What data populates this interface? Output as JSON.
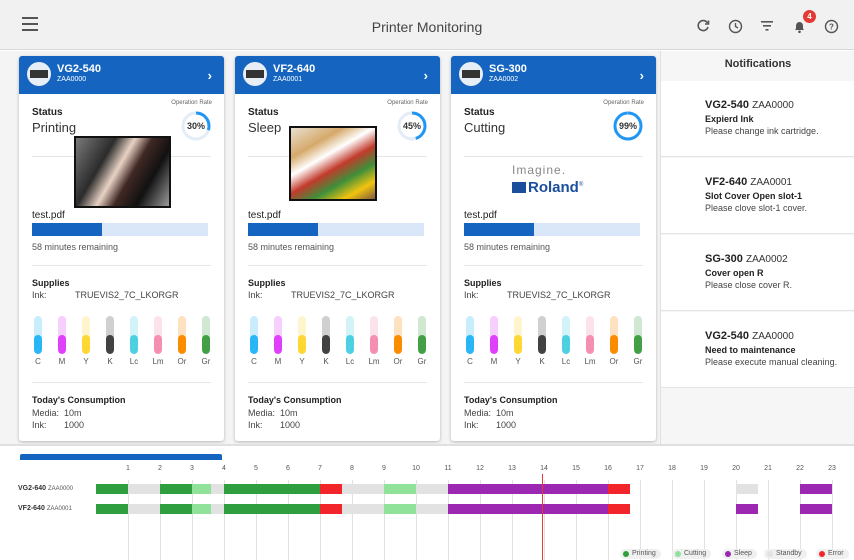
{
  "header": {
    "title": "Printer Monitoring",
    "notification_count": "4"
  },
  "common": {
    "status_label": "Status",
    "operation_rate_label": "Operation Rate",
    "supplies_label": "Supplies",
    "ink_label": "Ink:",
    "consumption_label": "Today's Consumption",
    "media_label": "Media:",
    "ink_row_label": "Ink:"
  },
  "cards": [
    {
      "name": "VG2-540",
      "id": "ZAA0000",
      "status": "Printing",
      "rate": 30,
      "rate_label": "30%",
      "job": "test.pdf",
      "progress": 0.4,
      "remaining": "58 minutes remaining",
      "ink_name": "TRUEVIS2_7C_LKORGR",
      "media": "10m",
      "ink": "1000"
    },
    {
      "name": "VF2-640",
      "id": "ZAA0001",
      "status": "Sleep",
      "rate": 45,
      "rate_label": "45%",
      "job": "test.pdf",
      "progress": 0.4,
      "remaining": "58 minutes remaining",
      "ink_name": "TRUEVIS2_7C_LKORGR",
      "media": "10m",
      "ink": "1000"
    },
    {
      "name": "SG-300",
      "id": "ZAA0002",
      "status": "Cutting",
      "rate": 99,
      "rate_label": "99%",
      "job": "test.pdf",
      "progress": 0.4,
      "remaining": "58 minutes remaining",
      "ink_name": "TRUEVIS2_7C_LKORGR",
      "media": "10m",
      "ink": "1000"
    }
  ],
  "logo": {
    "tagline": "Imagine.",
    "brand": "Roland",
    "tm": "®"
  },
  "inks": [
    {
      "label": "C",
      "color": "#29b6f6",
      "level": 0.5
    },
    {
      "label": "M",
      "color": "#e040fb",
      "level": 0.5
    },
    {
      "label": "Y",
      "color": "#fdd835",
      "level": 0.5
    },
    {
      "label": "K",
      "color": "#424242",
      "level": 0.5
    },
    {
      "label": "Lc",
      "color": "#4dd0e1",
      "level": 0.5
    },
    {
      "label": "Lm",
      "color": "#f48fb1",
      "level": 0.5
    },
    {
      "label": "Or",
      "color": "#fb8c00",
      "level": 0.5
    },
    {
      "label": "Gr",
      "color": "#43a047",
      "level": 0.5
    }
  ],
  "notifications": {
    "title": "Notifications",
    "items": [
      {
        "printer": "VG2-540",
        "id": "ZAA0000",
        "title": "Expierd Ink",
        "message": "Please change ink cartridge."
      },
      {
        "printer": "VF2-640",
        "id": "ZAA0001",
        "title": "Slot Cover Open slot-1",
        "message": "Please clove slot-1 cover."
      },
      {
        "printer": "SG-300",
        "id": "ZAA0002",
        "title": "Cover open R",
        "message": "Please close cover R."
      },
      {
        "printer": "VG2-540",
        "id": "ZAA0000",
        "title": "Need to maintenance",
        "message": "Please execute manual cleaning."
      }
    ]
  },
  "timeline": {
    "hours": [
      "1",
      "2",
      "3",
      "4",
      "5",
      "6",
      "7",
      "8",
      "9",
      "10",
      "11",
      "12",
      "13",
      "14",
      "15",
      "16",
      "17",
      "18",
      "19",
      "20",
      "21",
      "22",
      "23"
    ],
    "rows": [
      {
        "name": "VG2-640",
        "id": "ZAA0000",
        "segments": [
          {
            "state": "printing",
            "start": 0,
            "end": 1
          },
          {
            "state": "standby",
            "start": 1,
            "end": 2
          },
          {
            "state": "printing",
            "start": 2,
            "end": 3
          },
          {
            "state": "cutting",
            "start": 3,
            "end": 3.6
          },
          {
            "state": "standby",
            "start": 3.6,
            "end": 4
          },
          {
            "state": "printing",
            "start": 4,
            "end": 7
          },
          {
            "state": "error",
            "start": 7,
            "end": 7.7
          },
          {
            "state": "standby",
            "start": 7.7,
            "end": 9
          },
          {
            "state": "cutting",
            "start": 9,
            "end": 10
          },
          {
            "state": "standby",
            "start": 10,
            "end": 11
          },
          {
            "state": "sleep",
            "start": 11,
            "end": 16
          },
          {
            "state": "error",
            "start": 16,
            "end": 16.7
          },
          {
            "state": "standby",
            "start": 20,
            "end": 20.7
          },
          {
            "state": "sleep",
            "start": 22,
            "end": 23
          }
        ]
      },
      {
        "name": "VF2-640",
        "id": "ZAA0001",
        "segments": [
          {
            "state": "printing",
            "start": 0,
            "end": 1
          },
          {
            "state": "standby",
            "start": 1,
            "end": 2
          },
          {
            "state": "printing",
            "start": 2,
            "end": 3
          },
          {
            "state": "cutting",
            "start": 3,
            "end": 3.6
          },
          {
            "state": "standby",
            "start": 3.6,
            "end": 4
          },
          {
            "state": "printing",
            "start": 4,
            "end": 7
          },
          {
            "state": "error",
            "start": 7,
            "end": 7.7
          },
          {
            "state": "standby",
            "start": 7.7,
            "end": 9
          },
          {
            "state": "cutting",
            "start": 9,
            "end": 10
          },
          {
            "state": "standby",
            "start": 10,
            "end": 11
          },
          {
            "state": "sleep",
            "start": 11,
            "end": 16
          },
          {
            "state": "error",
            "start": 16,
            "end": 16.7
          },
          {
            "state": "sleep",
            "start": 20,
            "end": 20.7
          },
          {
            "state": "sleep",
            "start": 22,
            "end": 23
          }
        ]
      }
    ],
    "now": 13.95,
    "legend": [
      {
        "key": "printing",
        "label": "Printing",
        "color": "#2e9e3e"
      },
      {
        "key": "cutting",
        "label": "Cutting",
        "color": "#90e29a"
      },
      {
        "key": "sleep",
        "label": "Sleep",
        "color": "#9c27b0"
      },
      {
        "key": "standby",
        "label": "Standby",
        "color": "#e2e2e2"
      },
      {
        "key": "error",
        "label": "Error",
        "color": "#f2262a"
      }
    ]
  }
}
